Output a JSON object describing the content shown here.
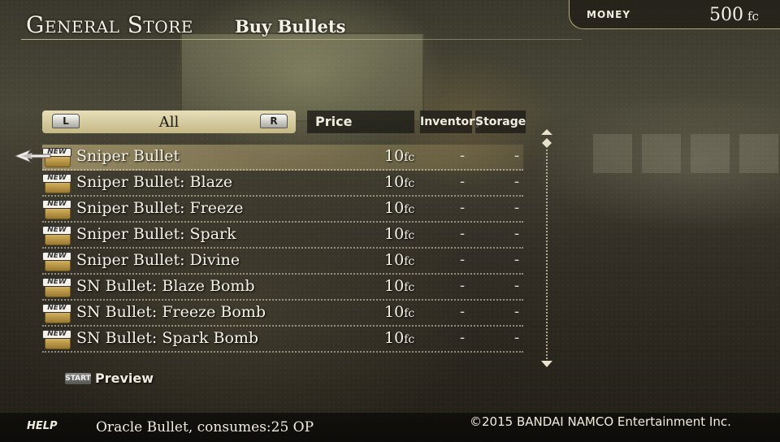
{
  "header": {
    "title": "General Store",
    "subtitle": "Buy Bullets"
  },
  "money": {
    "label": "MONEY",
    "value": "500",
    "unit": "fc"
  },
  "filter": {
    "left_button": "L",
    "right_button": "R",
    "label": "All"
  },
  "columns": {
    "price": "Price",
    "inventory": "Inventory",
    "storage": "Storage"
  },
  "items": [
    {
      "badge": "NEW",
      "name": "Sniper Bullet",
      "price": "10",
      "unit": "fc",
      "inventory": "-",
      "storage": "-",
      "selected": true
    },
    {
      "badge": "NEW",
      "name": "Sniper Bullet: Blaze",
      "price": "10",
      "unit": "fc",
      "inventory": "-",
      "storage": "-"
    },
    {
      "badge": "NEW",
      "name": "Sniper Bullet: Freeze",
      "price": "10",
      "unit": "fc",
      "inventory": "-",
      "storage": "-"
    },
    {
      "badge": "NEW",
      "name": "Sniper Bullet: Spark",
      "price": "10",
      "unit": "fc",
      "inventory": "-",
      "storage": "-"
    },
    {
      "badge": "NEW",
      "name": "Sniper Bullet: Divine",
      "price": "10",
      "unit": "fc",
      "inventory": "-",
      "storage": "-"
    },
    {
      "badge": "NEW",
      "name": "SN Bullet: Blaze Bomb",
      "price": "10",
      "unit": "fc",
      "inventory": "-",
      "storage": "-"
    },
    {
      "badge": "NEW",
      "name": "SN Bullet: Freeze Bomb",
      "price": "10",
      "unit": "fc",
      "inventory": "-",
      "storage": "-"
    },
    {
      "badge": "NEW",
      "name": "SN Bullet: Spark Bomb",
      "price": "10",
      "unit": "fc",
      "inventory": "-",
      "storage": "-"
    }
  ],
  "preview": {
    "button": "START",
    "label": "Preview"
  },
  "footer": {
    "help_label": "HELP",
    "help_text": "Oracle Bullet, consumes:25 OP",
    "copyright": "©2015 BANDAI NAMCO Entertainment Inc."
  },
  "colors": {
    "accent": "#c5b887",
    "selected_row": "#d8c48a",
    "text": "#f4f1e6"
  },
  "icons": {
    "cursor": "pointer-arrow-icon",
    "scroll_up": "scroll-up-arrow-icon",
    "scroll_down": "scroll-down-arrow-icon",
    "item": "ammo-box-icon"
  }
}
